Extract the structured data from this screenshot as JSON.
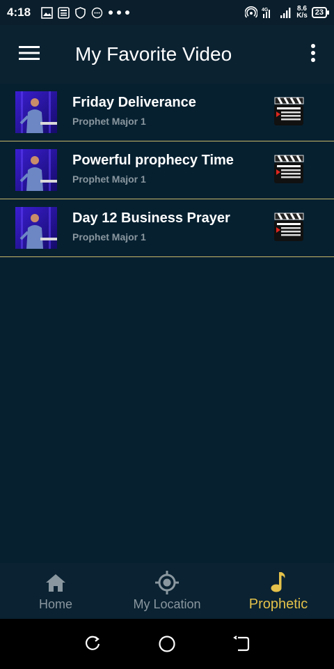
{
  "status_bar": {
    "time": "4:18",
    "network_speed_value": "8.6",
    "network_speed_unit": "K/s",
    "network_type": "4G",
    "battery": "23",
    "left_icons": [
      "image-icon",
      "news-icon",
      "shield-icon",
      "message-icon",
      "more-dots-icon"
    ]
  },
  "app_bar": {
    "title": "My Favorite Video",
    "menu_icon": "hamburger-menu-icon",
    "overflow_icon": "more-vertical-icon"
  },
  "videos": [
    {
      "title": "Friday Deliverance",
      "subtitle": "Prophet Major 1"
    },
    {
      "title": "Powerful prophecy Time",
      "subtitle": "Prophet Major 1"
    },
    {
      "title": "Day 12 Business Prayer",
      "subtitle": "Prophet Major 1"
    }
  ],
  "bottom_nav": {
    "items": [
      {
        "label": "Home",
        "icon": "home-icon",
        "active": false
      },
      {
        "label": "My Location",
        "icon": "location-target-icon",
        "active": false
      },
      {
        "label": "Prophetic",
        "icon": "music-note-icon",
        "active": true
      }
    ]
  },
  "system_nav": [
    "recents-icon",
    "home-circle-icon",
    "back-icon"
  ],
  "colors": {
    "background": "#062030",
    "divider": "#c8b86a",
    "active_accent": "#e4c14a",
    "inactive": "#8a979f"
  }
}
